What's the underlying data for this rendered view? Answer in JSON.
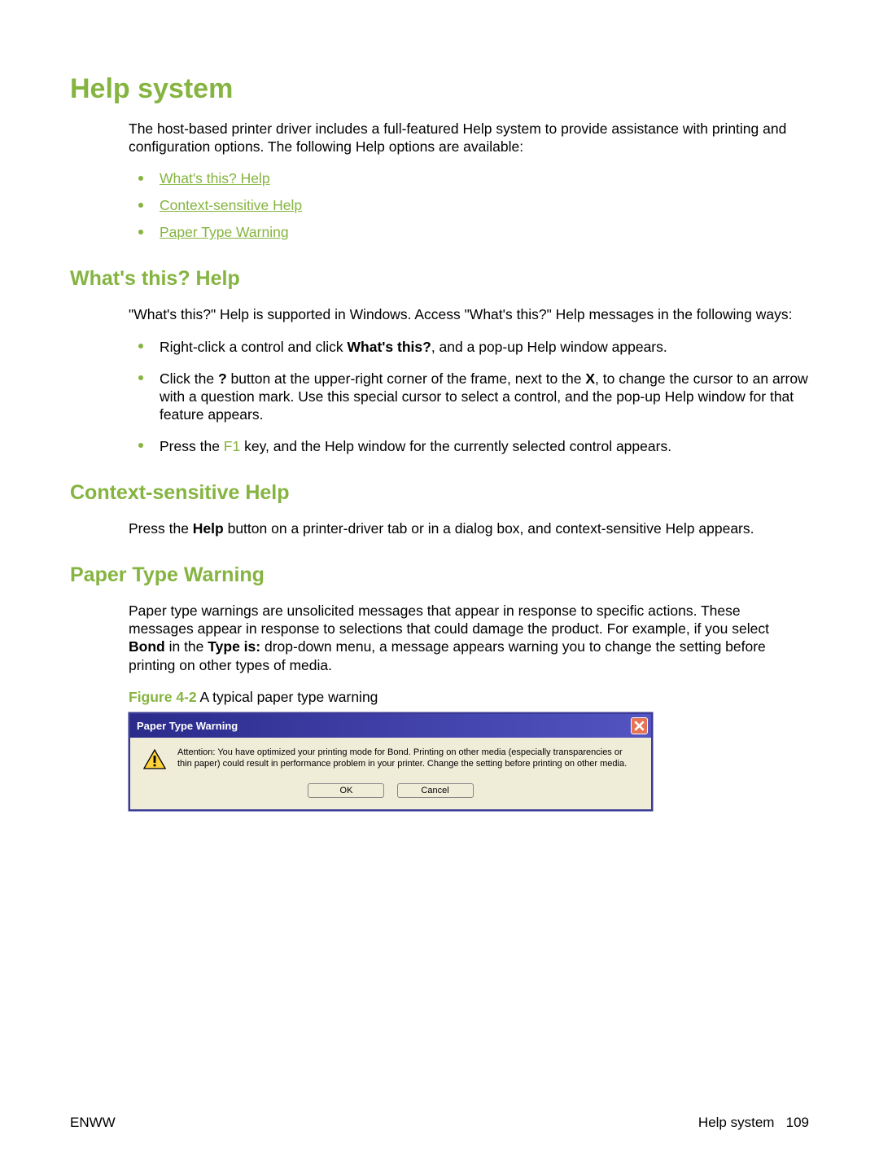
{
  "title": "Help system",
  "intro": "The host-based printer driver includes a full-featured Help system to provide assistance with printing and configuration options. The following Help options are available:",
  "links": [
    "What's this? Help",
    "Context-sensitive Help",
    "Paper Type Warning"
  ],
  "s1": {
    "heading": "What's this? Help",
    "intro": "\"What's this?\" Help is supported in Windows. Access \"What's this?\" Help messages in the following ways:",
    "bullets": {
      "b0_pre": "Right-click a control and click ",
      "b0_bold": "What's this?",
      "b0_post": ", and a pop-up Help window appears.",
      "b1_a": "Click the ",
      "b1_q": "?",
      "b1_b": " button at the upper-right corner of the frame, next to the ",
      "b1_x": "X",
      "b1_c": ", to change the cursor to an arrow with a question mark. Use this special cursor to select a control, and the pop-up Help window for that feature appears.",
      "b2_a": "Press the ",
      "b2_f1": "F1",
      "b2_b": " key, and the Help window for the currently selected control appears."
    }
  },
  "s2": {
    "heading": "Context-sensitive Help",
    "body_a": "Press the ",
    "body_help": "Help",
    "body_b": " button on a printer-driver tab or in a dialog box, and context-sensitive Help appears."
  },
  "s3": {
    "heading": "Paper Type Warning",
    "body_a": "Paper type warnings are unsolicited messages that appear in response to specific actions. These messages appear in response to selections that could damage the product. For example, if you select ",
    "body_bond": "Bond",
    "body_b": " in the ",
    "body_typeis": "Type is:",
    "body_c": " drop-down menu, a message appears warning you to change the setting before printing on other types of media.",
    "figlabel": "Figure 4-2",
    "figcap": "  A typical paper type warning"
  },
  "dialog": {
    "title": "Paper Type Warning",
    "message": "Attention: You have optimized your printing mode for Bond. Printing on other media (especially transparencies or thin paper) could result in performance problem in your printer. Change the setting before printing on other media.",
    "ok": "OK",
    "cancel": "Cancel"
  },
  "footer": {
    "left": "ENWW",
    "right_label": "Help system",
    "page": "109"
  }
}
